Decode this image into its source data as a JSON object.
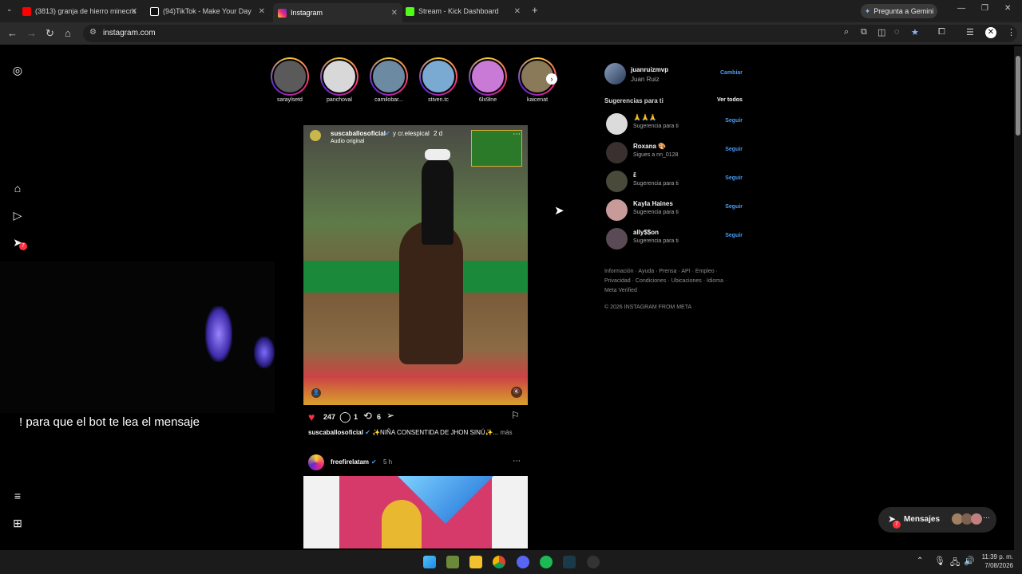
{
  "tabs": [
    {
      "label": "(3813) granja de hierro minecra",
      "icon": "youtube-icon",
      "color": "#ff0000"
    },
    {
      "label": "(94)TikTok - Make Your Day",
      "icon": "tiktok-icon",
      "color": "#ffffff"
    },
    {
      "label": "Instagram",
      "icon": "instagram-icon",
      "color": "#e1306c"
    },
    {
      "label": "Stream - Kick Dashboard",
      "icon": "kick-icon",
      "color": "#53fc18"
    }
  ],
  "gemini_label": "Pregunta a Gemini",
  "url": "instagram.com",
  "stories": [
    "saraylsetd",
    "panchoval",
    "camilobar...",
    "stiven.tc",
    "6lx9lne",
    "kaicenat"
  ],
  "post": {
    "user": "suscaballosoficial",
    "collab": "y cr.elespical",
    "age": "2 d",
    "audio": "Audio original",
    "likes": "247",
    "comments": "1",
    "reposts": "6",
    "caption_user": "suscaballosoficial",
    "caption": "✨NIÑA CONSENTIDA DE JHON SINÚ✨...",
    "more": "más"
  },
  "post2": {
    "user": "freefirelatam",
    "age": "5 h"
  },
  "overlay_text": "! para que el bot te lea el mensaje",
  "nav_badge": "7",
  "profile": {
    "username": "juanruizmvp",
    "name": "Juan Ruiz",
    "switch": "Cambiar"
  },
  "suggestions_title": "Sugerencias para ti",
  "see_all": "Ver todos",
  "suggestions": [
    {
      "name": "🙏🙏🙏",
      "sub": "Sugerencia para ti",
      "follow": "Seguir"
    },
    {
      "name": "Roxana 🎨",
      "sub": "Sigues a nn_0128",
      "follow": "Seguir"
    },
    {
      "name": "ɛ̃",
      "sub": "Sugerencia para ti",
      "follow": "Seguir"
    },
    {
      "name": "Kayla Haines",
      "sub": "Sugerencia para ti",
      "follow": "Seguir"
    },
    {
      "name": "ally$$on",
      "sub": "Sugerencia para ti",
      "follow": "Seguir"
    }
  ],
  "footer_links_1": "Información · Ayuda · Prensa · API · Empleo ·",
  "footer_links_2": "Privacidad · Condiciones · Ubicaciones · Idioma ·",
  "footer_links_3": "Meta Verified",
  "copyright": "© 2026 INSTAGRAM FROM META",
  "messages": {
    "label": "Mensajes",
    "badge": "7"
  },
  "clock": {
    "time": "11:39 p. m.",
    "date": "7/08/2026"
  }
}
